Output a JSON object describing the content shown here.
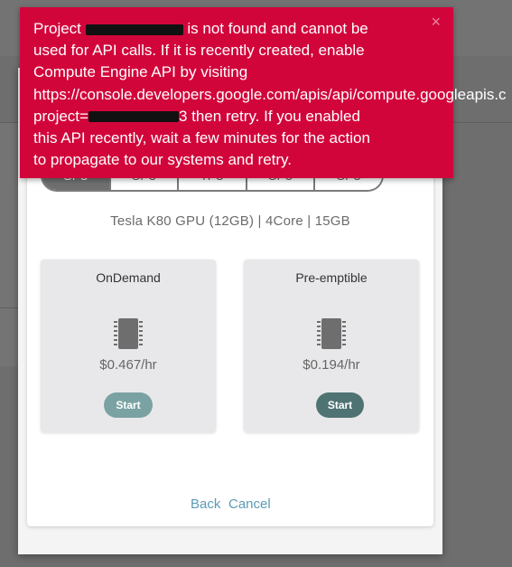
{
  "tabs": [
    {
      "label": "GPU",
      "active": true
    },
    {
      "label": "GPU",
      "active": false
    },
    {
      "label": "TPU",
      "active": false
    },
    {
      "label": "GPU",
      "active": false
    },
    {
      "label": "GPU",
      "active": false
    }
  ],
  "machine_spec": "Tesla K80 GPU (12GB) | 4Core | 15GB",
  "options": {
    "ondemand": {
      "title": "OnDemand",
      "price": "$0.467/hr",
      "start_label": "Start",
      "icon": "chip-icon"
    },
    "preemptible": {
      "title": "Pre-emptible",
      "price": "$0.194/hr",
      "start_label": "Start",
      "icon": "chip-icon"
    }
  },
  "footer": {
    "back_label": "Back",
    "cancel_label": "Cancel"
  },
  "error": {
    "line1_a": "Project ",
    "line1_b": " is not found and cannot be",
    "line2": "used for API calls. If it is recently created, enable",
    "line3": "Compute Engine API by visiting",
    "line4": "https://console.developers.google.com/apis/api/compute.googleapis.c",
    "line5_a": "project=",
    "line5_b": "3 then retry. If you enabled",
    "line6": "this API recently, wait a few minutes for the action",
    "line7": "to propagate to our systems and retry.",
    "close_glyph": "×"
  },
  "colors": {
    "error_bg": "#d2053b",
    "start_ondemand": "#7aa2a2",
    "start_preemptible": "#4f7373",
    "link": "#5b9bb5"
  }
}
